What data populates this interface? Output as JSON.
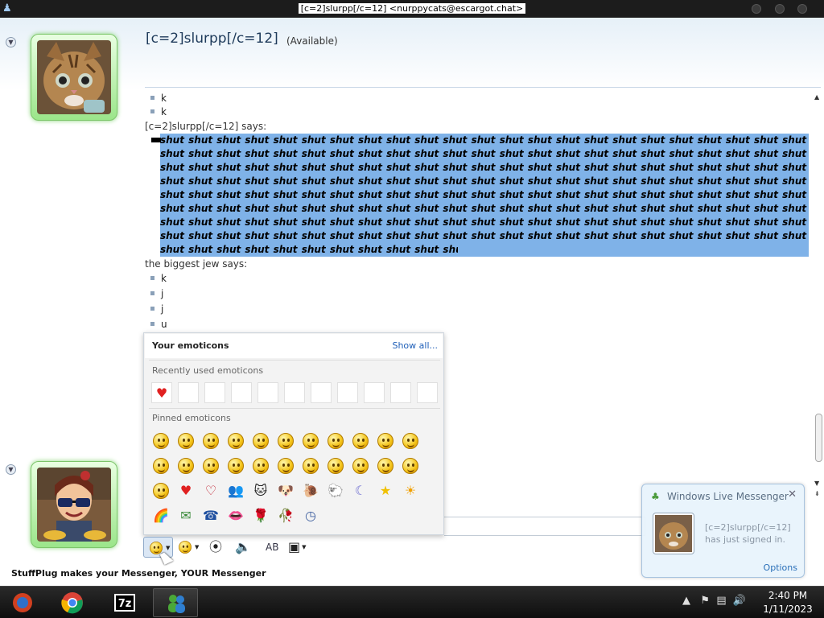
{
  "window": {
    "title": "[c=2]slurpp[/c=12] <nurppycats@escargot.chat>"
  },
  "header": {
    "contact_name": "[c=2]slurpp[/c=12]",
    "status": "(Available)"
  },
  "conversation": {
    "lines_top": [
      "k",
      "k"
    ],
    "sender1_says": "[c=2]slurpp[/c=12] says:",
    "shout_lines": [
      "shut shut shut shut shut shut shut shut shut shut shut shut shut shut shut shut shut shut shut shut shut shut shut shut shut shut",
      "shut shut shut shut shut shut shut shut shut shut shut shut shut shut shut shut shut shut shut shut shut shut shut shut shut shut",
      "shut shut shut shut shut shut shut shut shut shut shut shut shut shut shut shut shut shut shut shut shut shut shut shut shut shut",
      "shut shut shut shut shut shut shut shut shut shut shut shut shut shut shut shut shut shut shut shut shut shut shut shut shut shut",
      "shut shut shut shut shut shut shut shut shut shut shut shut shut shut shut shut shut shut shut shut shut shut shut shut shut shut",
      "shut shut shut shut shut shut shut shut shut shut shut shut shut shut shut shut shut shut shut shut shut shut shut shut shut shut",
      "shut shut shut shut shut shut shut shut shut shut shut shut shut shut shut shut shut shut shut shut shut shut shut shut shut shut",
      "shut shut shut shut shut shut shut shut shut shut shut shut shut shut shut shut shut shut shut shut shut shut shut shut shut shut",
      "shut shut shut shut shut shut shut shut shut shut shut"
    ],
    "sender2_says": "the biggest jew says:",
    "lines_bottom": [
      "k",
      "j",
      "j",
      "u"
    ]
  },
  "emoticons": {
    "title": "Your emoticons",
    "show_all": "Show all...",
    "recent_label": "Recently used emoticons",
    "recent": [
      "heart",
      "",
      "",
      "",
      "",
      "",
      "",
      "",
      "",
      "",
      ""
    ],
    "pinned_label": "Pinned emoticons",
    "pinned": [
      [
        "face",
        "face",
        "face",
        "face",
        "face",
        "face",
        "face",
        "face",
        "face",
        "face",
        "face"
      ],
      [
        "face",
        "face",
        "face",
        "face",
        "face",
        "face",
        "face",
        "face",
        "face",
        "face",
        "face"
      ],
      [
        "face",
        "heart",
        "broken-heart",
        "people",
        "cat",
        "dog",
        "snail",
        "sheep",
        "moon",
        "star",
        "sun"
      ],
      [
        "rainbow",
        "mail-person",
        "phone-person",
        "lips",
        "rose",
        "wilted-rose",
        "clock"
      ]
    ]
  },
  "toast": {
    "title": "Windows Live Messenger",
    "message": "[c=2]slurpp[/c=12] has just signed in.",
    "options": "Options"
  },
  "footer": {
    "stuffplug": "StuffPlug makes your Messenger, YOUR Messenger"
  },
  "taskbar": {
    "time": "2:40 PM",
    "date": "1/11/2023",
    "apps": [
      "stuffplug",
      "chrome",
      "7zip",
      "messenger"
    ]
  },
  "colors": {
    "selection": "#7fb2e8",
    "avatar_glow": "#8ad67a",
    "link": "#1f5fb8"
  }
}
